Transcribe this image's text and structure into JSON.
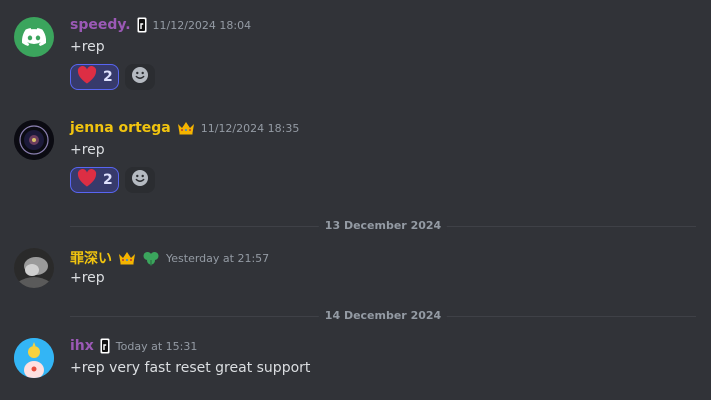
{
  "colors": {
    "background": "#313338",
    "username_purple": "#9b59b6",
    "username_gold": "#f1c40f",
    "reaction_active_bg": "#373a6b",
    "reaction_active_border": "#5865f2",
    "timestamp": "#949ba4",
    "text": "#dbdee1"
  },
  "messages": [
    {
      "username": "speedy.",
      "timestamp": "11/12/2024 18:04",
      "text": "+rep",
      "avatar_icon": "discord-logo-icon",
      "badge_icons": [
        "r-tag-icon"
      ],
      "reactions": [
        {
          "emoji_icon": "red-heart-icon",
          "count": "2",
          "active": true
        },
        {
          "emoji_icon": "add-reaction-icon"
        }
      ]
    },
    {
      "username": "jenna ortega",
      "timestamp": "11/12/2024 18:35",
      "text": "+rep",
      "avatar_icon": "circular-emblem-avatar-icon",
      "badge_icons": [
        "crown-icon"
      ],
      "reactions": [
        {
          "emoji_icon": "red-heart-icon",
          "count": "2",
          "active": true
        },
        {
          "emoji_icon": "add-reaction-icon"
        }
      ]
    },
    {
      "username": "罪深い",
      "timestamp": "Yesterday at 21:57",
      "text": "+rep",
      "avatar_icon": "grayscale-photo-avatar-icon",
      "badge_icons": [
        "crown-icon",
        "green-clover-icon"
      ]
    },
    {
      "username": "ihx",
      "timestamp": "Today at 15:31",
      "text": "+rep very fast reset great support",
      "avatar_icon": "cartoon-avatar-icon",
      "badge_icons": [
        "r-tag-icon"
      ]
    }
  ],
  "dividers": [
    {
      "label": "13 December 2024"
    },
    {
      "label": "14 December 2024"
    }
  ]
}
